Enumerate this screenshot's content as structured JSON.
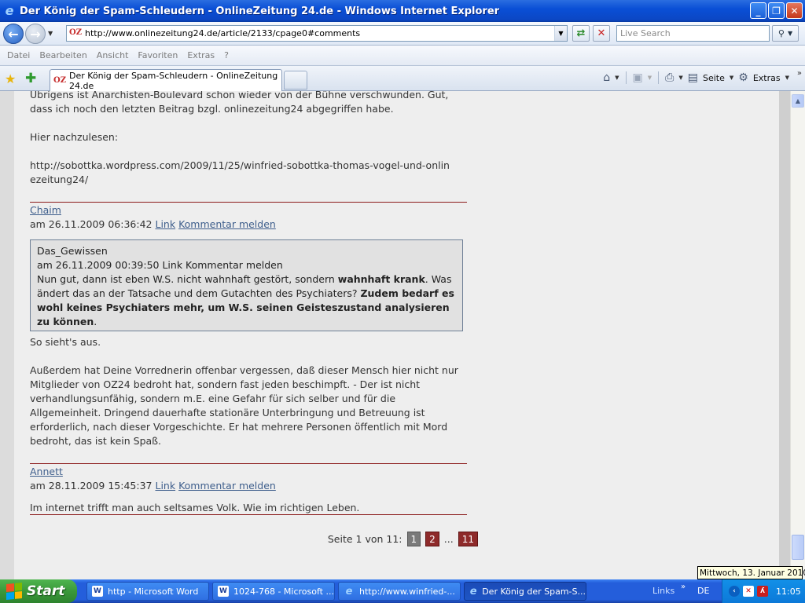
{
  "window": {
    "title": "Der König der Spam-Schleudern - OnlineZeitung 24.de - Windows Internet Explorer",
    "min": "_",
    "max": "❐",
    "close": "✕"
  },
  "address": {
    "url": "http://www.onlinezeitung24.de/article/2133/cpage0#comments",
    "search_placeholder": "Live Search"
  },
  "menu": [
    "Datei",
    "Bearbeiten",
    "Ansicht",
    "Favoriten",
    "Extras",
    "?"
  ],
  "tab": {
    "label": "Der König der Spam-Schleudern - OnlineZeitung 24.de"
  },
  "commands": {
    "page": "Seite",
    "tools": "Extras"
  },
  "article": {
    "top_text": "Übrigens ist Anarchisten-Boulevard schon wieder von der Bühne verschwunden. Gut, dass ich noch den letzten Beitrag bzgl. onlinezeitung24 abgegriffen habe.",
    "read_here": "Hier nachzulesen:",
    "link_url": "http://sobottka.wordpress.com/2009/11/25/winfried-sobottka-thomas-vogel-und-onlinezeitung24/",
    "link_action": "Link",
    "report_action": "Kommentar melden",
    "comments": [
      {
        "author": "Chaim",
        "date": "am 26.11.2009 06:36:42",
        "quote": {
          "author": "Das_Gewissen",
          "meta": "am 26.11.2009 00:39:50 Link Kommentar melden",
          "text_1": "Nun gut, dann ist eben W.S. nicht wahnhaft gestört, sondern ",
          "bold_1": "wahnhaft krank",
          "text_2": ". Was ändert das an der Tatsache und dem Gutachten des Psychiaters? ",
          "bold_2": "Zudem bedarf es wohl keines Psychiaters mehr, um W.S. seinen Geisteszustand analysieren zu können",
          "text_3": "."
        },
        "body_1": "So sieht's aus.",
        "body_2": "Außerdem hat Deine Vorrednerin offenbar vergessen, daß dieser Mensch hier nicht nur Mitglieder von OZ24 bedroht hat, sondern fast jeden beschimpft. - Der ist nicht verhandlungsunfähig, sondern m.E. eine Gefahr für sich selber und für die Allgemeinheit. Dringend dauerhafte stationäre Unterbringung und Betreuung ist erforderlich, nach dieser Vorgeschichte. Er hat mehrere Personen öffentlich mit Mord bedroht, das ist kein Spaß."
      },
      {
        "author": "Annett",
        "date": "am 28.11.2009 15:45:37",
        "body_1": "Im internet trifft man auch seltsames Volk. Wie im richtigen Leben."
      }
    ]
  },
  "pager": {
    "label": "Seite 1 von 11:",
    "pages": [
      "1",
      "2",
      "...",
      "11"
    ]
  },
  "tooltip": "Mittwoch, 13. Januar 2010",
  "taskbar": {
    "start": "Start",
    "buttons": [
      "http - Microsoft Word",
      "1024-768 - Microsoft ...",
      "http://www.winfried-...",
      "Der König der Spam-S..."
    ],
    "links": "Links",
    "lang": "DE",
    "clock": "11:05"
  },
  "icons": [
    "ie-logo-icon",
    "back-arrow-icon",
    "forward-arrow-icon",
    "refresh-icon",
    "stop-icon",
    "search-icon",
    "favorites-star-icon",
    "add-favorites-icon",
    "home-icon",
    "rss-feed-icon",
    "print-icon",
    "page-icon",
    "gear-icon",
    "windows-flag-icon",
    "word-doc-icon"
  ]
}
